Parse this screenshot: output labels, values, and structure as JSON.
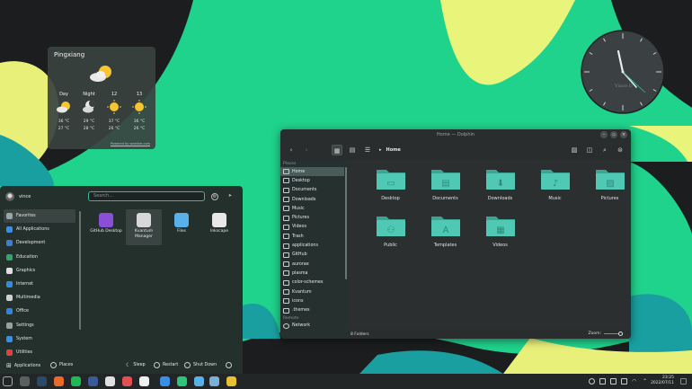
{
  "weather": {
    "city": "Pingxiang",
    "footer": "Powered by weather.com",
    "columns": [
      {
        "label": "Day",
        "high": "36 °C",
        "low": "27 °C",
        "icon": "sun-cloud-icon"
      },
      {
        "label": "Night",
        "high": "29 °C",
        "low": "28 °C",
        "icon": "moon-cloud-icon"
      },
      {
        "label": "12",
        "high": "37 °C",
        "low": "26 °C",
        "icon": "sun-icon"
      },
      {
        "label": "13",
        "high": "36 °C",
        "low": "26 °C",
        "icon": "sun-icon"
      }
    ]
  },
  "clock": {
    "brand": "Vince D"
  },
  "dolphin": {
    "window_title": "Home — Dolphin",
    "breadcrumb": "Home",
    "places_header": "Places",
    "remote_header": "Remote",
    "places": [
      "Home",
      "Desktop",
      "Documents",
      "Downloads",
      "Music",
      "Pictures",
      "Videos",
      "Trash",
      "applications",
      "GitHub",
      "aurorae",
      "plasma",
      "color-schemes",
      "Kvantum",
      "icons",
      ".themes"
    ],
    "remote": [
      "Network"
    ],
    "folders": [
      {
        "name": "Desktop",
        "glyph": "▭"
      },
      {
        "name": "Documents",
        "glyph": "▤"
      },
      {
        "name": "Downloads",
        "glyph": "⬇"
      },
      {
        "name": "Music",
        "glyph": "♪"
      },
      {
        "name": "Pictures",
        "glyph": "▨"
      },
      {
        "name": "Public",
        "glyph": "⚇"
      },
      {
        "name": "Templates",
        "glyph": "A"
      },
      {
        "name": "Videos",
        "glyph": "▦"
      }
    ],
    "status": "8 Folders",
    "zoom_label": "Zoom:",
    "accent": "#4fc9b3"
  },
  "launcher": {
    "user": "vince",
    "search_placeholder": "Search...",
    "categories": [
      {
        "label": "Favorites",
        "color": "#9aa6a6"
      },
      {
        "label": "All Applications",
        "color": "#3a8ee6"
      },
      {
        "label": "Development",
        "color": "#3b7dd8"
      },
      {
        "label": "Education",
        "color": "#2ea86b"
      },
      {
        "label": "Graphics",
        "color": "#e0e0e0"
      },
      {
        "label": "Internet",
        "color": "#2f8de4"
      },
      {
        "label": "Multimedia",
        "color": "#d0d0d0"
      },
      {
        "label": "Office",
        "color": "#2d86e0"
      },
      {
        "label": "Settings",
        "color": "#9aa0a0"
      },
      {
        "label": "System",
        "color": "#3a8ee6"
      },
      {
        "label": "Utilities",
        "color": "#e04040"
      }
    ],
    "apps": [
      {
        "name": "GitHub Desktop",
        "color": "#8a4fd6"
      },
      {
        "name": "Kvantum Manager",
        "color": "#d8d8d8"
      },
      {
        "name": "Files",
        "color": "#5ab0e8"
      },
      {
        "name": "Inkscape",
        "color": "#e8e8e8"
      }
    ],
    "footer": {
      "applications": "Applications",
      "places": "Places",
      "sleep": "Sleep",
      "restart": "Restart",
      "shutdown": "Shut Down"
    }
  },
  "taskbar": {
    "time": "23:25",
    "date": "2022/07/11",
    "apps": [
      {
        "name": "launcher",
        "color": "#3c4344"
      },
      {
        "name": "system-settings",
        "color": "#5a6060"
      },
      {
        "name": "steam",
        "color": "#2a4a6a"
      },
      {
        "name": "firefox",
        "color": "#e86a2a"
      },
      {
        "name": "spotify",
        "color": "#1db954"
      },
      {
        "name": "virtualbox",
        "color": "#3a5a9a"
      },
      {
        "name": "photos",
        "color": "#e0e0e0"
      },
      {
        "name": "kde-connect",
        "color": "#e05050"
      },
      {
        "name": "chrome-blue",
        "color": "#f0f0f0"
      },
      {
        "name": "kate",
        "color": "#3a8ee6"
      },
      {
        "name": "music",
        "color": "#2ec47a"
      },
      {
        "name": "dolphin",
        "color": "#5ab0e8"
      },
      {
        "name": "files",
        "color": "#7ab0d8"
      },
      {
        "name": "chrome",
        "color": "#e8c030"
      }
    ]
  }
}
